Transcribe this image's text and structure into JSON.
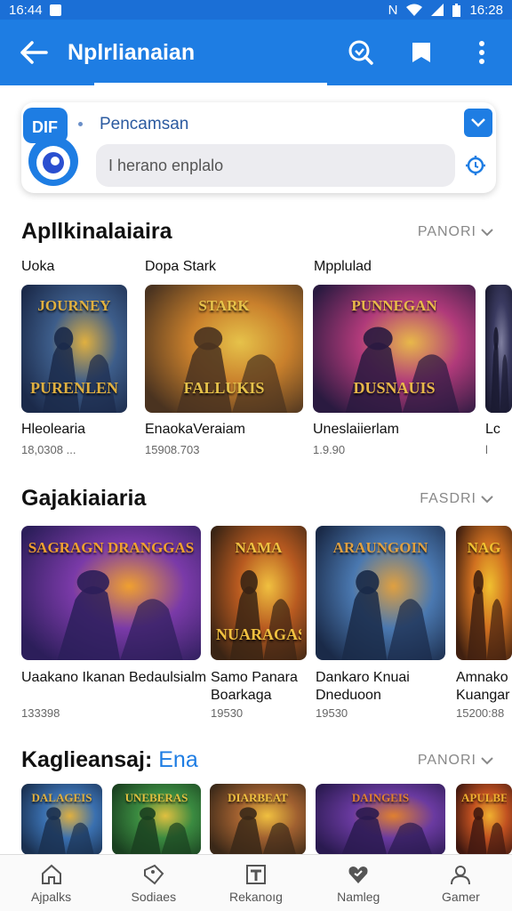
{
  "status_bar": {
    "time_left": "16:44",
    "time_right": "16:28"
  },
  "app_bar": {
    "title": "Nplrlianaian"
  },
  "search": {
    "label": "Pencamsan",
    "placeholder": "I herano enplalo",
    "logo_text": "DIF"
  },
  "sections": [
    {
      "title": "Apllkinalaiaira",
      "title_accent": "",
      "more": "PANORI",
      "row_labels": [
        "Uoka",
        "Dopa Stark",
        "Mpplulad"
      ],
      "items": [
        {
          "art_title": "JOURNEY",
          "art_title2": "PURENLEN",
          "caption": "Hleolearia",
          "sub": "18,0308 ...",
          "colors": [
            "#1b2a4a",
            "#3d5d8a",
            "#e0b040"
          ]
        },
        {
          "art_title": "STARK",
          "art_title2": "FALLUKIS",
          "caption": "EnaokaVeraiam",
          "sub": "15908.703",
          "colors": [
            "#4a3320",
            "#c9802c",
            "#e6c24a"
          ]
        },
        {
          "art_title": "PUNNEGAN",
          "art_title2": "DUSNAUIS",
          "caption": "Uneslaiierlam",
          "sub": "1.9.90",
          "colors": [
            "#2a1a40",
            "#b03a7a",
            "#e8b84a"
          ]
        },
        {
          "art_title": "",
          "art_title2": "",
          "caption": "Lc",
          "sub": "l",
          "colors": [
            "#1a1a30",
            "#3a3a60",
            "#8080a0"
          ]
        }
      ]
    },
    {
      "title": "Gajakiaiaria",
      "title_accent": "",
      "more": "FASDRI",
      "row_labels": [],
      "items": [
        {
          "art_title": "SAGRAGN DRANGGAS",
          "art_title2": "",
          "caption": "Uaakano Ikanan Bedaulsialm",
          "sub": "133398",
          "colors": [
            "#2c1e5a",
            "#7a3aa8",
            "#f0a030"
          ]
        },
        {
          "art_title": "NAMA",
          "art_title2": "NUARAGAS",
          "caption": "Samo Panara Boarkaga",
          "sub": "19530",
          "colors": [
            "#3a2414",
            "#b85a20",
            "#f0c040"
          ]
        },
        {
          "art_title": "ARAUNGOIN",
          "art_title2": "",
          "caption": "Dankaro Knuai Dneduoon",
          "sub": "19530",
          "colors": [
            "#1a2a48",
            "#4a78b0",
            "#e0a040"
          ]
        },
        {
          "art_title": "NAG",
          "art_title2": "",
          "caption": "Amnako Kuangar",
          "sub": "15200:88",
          "colors": [
            "#402010",
            "#d07020",
            "#f0c030"
          ]
        }
      ]
    },
    {
      "title": "Kaglieansaj:",
      "title_accent": "Ena",
      "more": "PANORI",
      "row_labels": [],
      "items": [
        {
          "art_title": "DALAGEIS",
          "art_title2": "",
          "caption": "",
          "sub": "",
          "colors": [
            "#1a3050",
            "#3a70b0",
            "#e0b040"
          ]
        },
        {
          "art_title": "UNEBERAS",
          "art_title2": "",
          "caption": "",
          "sub": "",
          "colors": [
            "#1a4020",
            "#3a8a40",
            "#e0c040"
          ]
        },
        {
          "art_title": "DIARBEAT",
          "art_title2": "",
          "caption": "",
          "sub": "",
          "colors": [
            "#3a2818",
            "#a06030",
            "#f0c040"
          ]
        },
        {
          "art_title": "DAINGEIS",
          "art_title2": "",
          "caption": "",
          "sub": "",
          "colors": [
            "#2a1a50",
            "#6a3aa0",
            "#e08030"
          ]
        },
        {
          "art_title": "APULBEN",
          "art_title2": "",
          "caption": "",
          "sub": "",
          "colors": [
            "#401810",
            "#c05020",
            "#f0b030"
          ]
        }
      ]
    }
  ],
  "bottom_nav": [
    {
      "label": "Ajpalks",
      "icon": "home-icon"
    },
    {
      "label": "Sodiaes",
      "icon": "tag-icon"
    },
    {
      "label": "Rekanoıg",
      "icon": "grid-icon"
    },
    {
      "label": "Namleg",
      "icon": "heart-icon"
    },
    {
      "label": "Gamer",
      "icon": "person-icon"
    }
  ],
  "colors": {
    "primary": "#1e7de3",
    "status": "#1b6fd6"
  }
}
